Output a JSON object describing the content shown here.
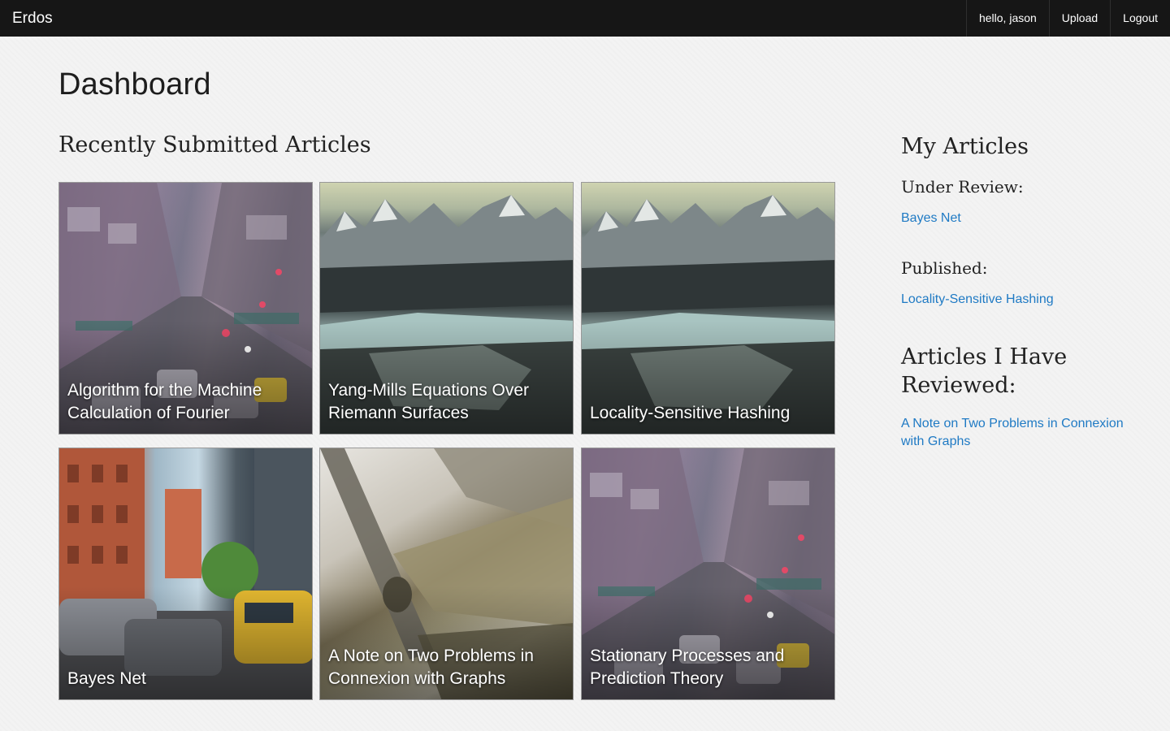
{
  "navbar": {
    "brand": "Erdos",
    "items": [
      {
        "label": "hello, jason"
      },
      {
        "label": "Upload"
      },
      {
        "label": "Logout"
      }
    ]
  },
  "page": {
    "title": "Dashboard"
  },
  "recent": {
    "title": "Recently Submitted Articles",
    "articles": [
      {
        "title": "Algorithm for the Machine Calculation of Fourier",
        "image": "city-traffic"
      },
      {
        "title": "Yang-Mills Equations Over Riemann Surfaces",
        "image": "mountain-lake"
      },
      {
        "title": "Locality-Sensitive Hashing",
        "image": "mountain-lake"
      },
      {
        "title": "Bayes Net",
        "image": "street-bridge-taxi"
      },
      {
        "title": "A Note on Two Problems in Connexion with Graphs",
        "image": "metal-closeup"
      },
      {
        "title": "Stationary Processes and Prediction Theory",
        "image": "city-traffic"
      }
    ]
  },
  "my_articles": {
    "title": "My Articles",
    "under_review": {
      "label": "Under Review:",
      "items": [
        "Bayes Net"
      ]
    },
    "published": {
      "label": "Published:",
      "items": [
        "Locality-Sensitive Hashing"
      ]
    }
  },
  "reviewed": {
    "title": "Articles I Have Reviewed:",
    "items": [
      "A Note on Two Problems in Connexion with Graphs"
    ]
  },
  "colors": {
    "navbar": "#161616",
    "link": "#1f7ac4",
    "background": "#f3f3f3"
  }
}
